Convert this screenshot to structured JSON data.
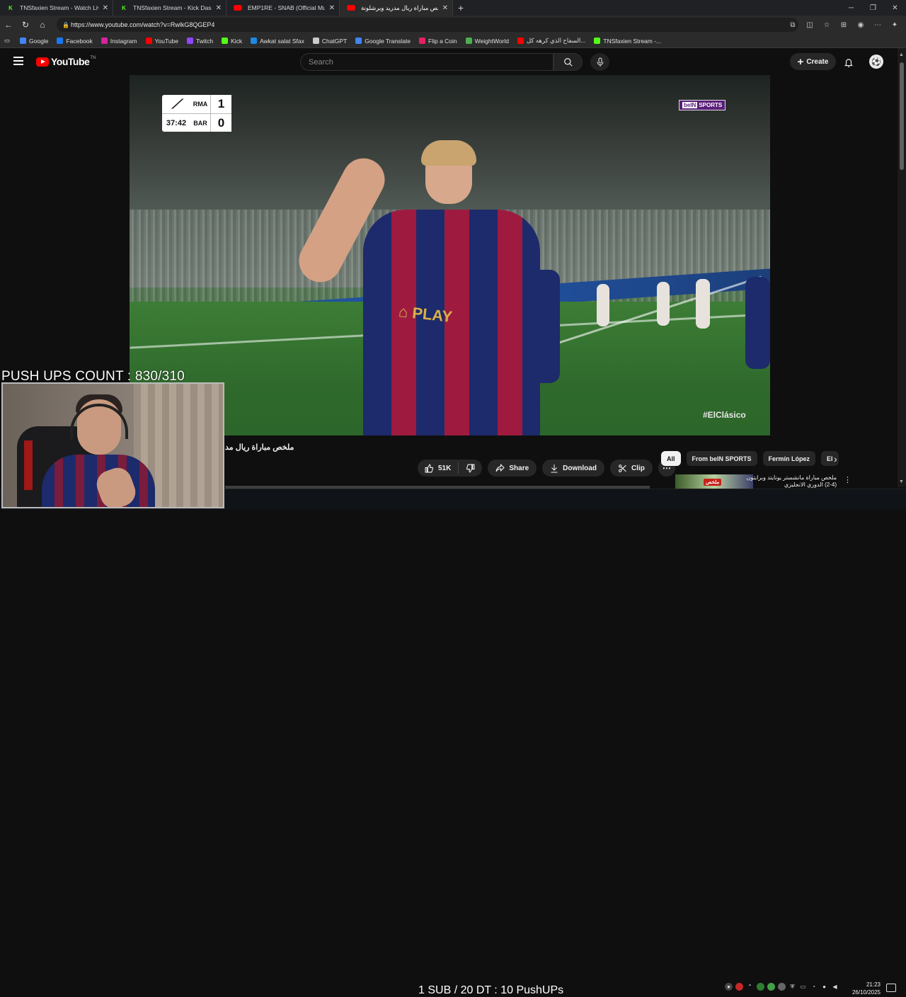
{
  "browser": {
    "tabs": [
      {
        "title": "TNSfaxien Stream - Watch Live on",
        "icon": "kick-icon",
        "active": false
      },
      {
        "title": "TNSfaxien Stream - Kick Dashboa",
        "icon": "kick-icon",
        "active": false
      },
      {
        "title": "EMP1RE - SNAB (Official Music V",
        "icon": "youtube-icon",
        "active": false
      },
      {
        "title": "ملخص مباراة ريال مدريد وبرشلونة",
        "icon": "youtube-icon",
        "active": true
      }
    ],
    "url": "https://www.youtube.com/watch?v=RwlkG8QGEP4",
    "bookmarks": [
      {
        "label": "Google",
        "icon": "google-icon",
        "color": "#4285f4"
      },
      {
        "label": "Facebook",
        "icon": "facebook-icon",
        "color": "#1877f2"
      },
      {
        "label": "Instagram",
        "icon": "instagram-icon",
        "color": "#d6249f"
      },
      {
        "label": "YouTube",
        "icon": "youtube-icon",
        "color": "#ff0000"
      },
      {
        "label": "Twitch",
        "icon": "twitch-icon",
        "color": "#9146ff"
      },
      {
        "label": "Kick",
        "icon": "kick-icon",
        "color": "#53fc18"
      },
      {
        "label": "Awkat salat Sfax",
        "icon": "book-icon",
        "color": "#1e88e5"
      },
      {
        "label": "ChatGPT",
        "icon": "chatgpt-icon",
        "color": "#cccccc"
      },
      {
        "label": "Google Translate",
        "icon": "translate-icon",
        "color": "#4285f4"
      },
      {
        "label": "Flip a Coin",
        "icon": "coin-icon",
        "color": "#e91e63"
      },
      {
        "label": "WeightWorld",
        "icon": "weightworld-icon",
        "color": "#4caf50"
      },
      {
        "label": "السفاح الذي كرهه كل...",
        "icon": "youtube-icon",
        "color": "#ff0000"
      },
      {
        "label": "TNSfaxien Stream -...",
        "icon": "kick-icon",
        "color": "#53fc18"
      }
    ]
  },
  "youtube": {
    "logo_text": "YouTube",
    "country": "TN",
    "search_placeholder": "Search",
    "create_label": "Create"
  },
  "video": {
    "scoreboard": {
      "home": "RMA",
      "away": "BAR",
      "home_score": "1",
      "away_score": "0",
      "clock": "37:42"
    },
    "broadcaster": {
      "logo_prefix": "beIN",
      "logo_suffix": "SPORTS"
    },
    "hashtag": "#ElClásico",
    "title": "ملخص مباراة ريال مد",
    "likes": "51K",
    "share_label": "Share",
    "download_label": "Download",
    "clip_label": "Clip"
  },
  "overlay": {
    "push_ups_count": "PUSH UPS COUNT : 830/310",
    "bottom_text": "1 SUB / 20 DT : 10 PushUPs"
  },
  "filters": {
    "chips": [
      "All",
      "From beIN SPORTS",
      "Fermín López",
      "El"
    ]
  },
  "recommendation": {
    "title": "ملخص مباراة مانشستر يونايتد وبرايتون (4-2) الدوري الانجليزي",
    "badge": "ملخص"
  },
  "taskbar": {
    "time": "21:23",
    "date": "26/10/2025"
  }
}
